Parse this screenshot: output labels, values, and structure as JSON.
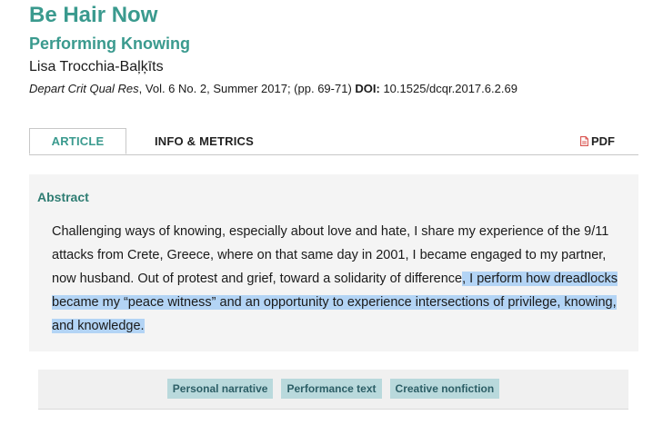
{
  "article": {
    "title": "Be Hair Now",
    "subtitle": "Performing Knowing",
    "author": "Lisa Trocchia-Baļķīts",
    "citation": {
      "journal": "Depart Crit Qual Res",
      "volume_issue": ", Vol. 6 No. 2, Summer 2017; (pp. 69-71) ",
      "doi_label": "DOI:",
      "doi": " 10.1525/dcqr.2017.6.2.69"
    }
  },
  "tabs": [
    {
      "label": "ARTICLE",
      "active": true
    },
    {
      "label": "INFO & METRICS",
      "active": false
    }
  ],
  "pdf": {
    "label": "PDF",
    "icon": "pdf-file-icon"
  },
  "abstract": {
    "heading": "Abstract",
    "text_before": "Challenging ways of knowing, especially about love and hate, I share my experience of the 9/11 attacks from Crete, Greece, where on that same day in 2001, I became engaged to my partner, now husband. Out of protest and grief, toward a solidarity of difference",
    "text_selected": ", I perform how dreadlocks became my “peace witness” and an opportunity to experience intersections of privilege, knowing, and knowledge."
  },
  "keywords": [
    "Personal narrative",
    "Performance text",
    "Creative nonfiction"
  ],
  "colors": {
    "accent": "#3a9a8e",
    "selection": "#b3d4f5",
    "keyword_bg": "#b9d9dc",
    "panel_bg": "#f4f4f4"
  }
}
